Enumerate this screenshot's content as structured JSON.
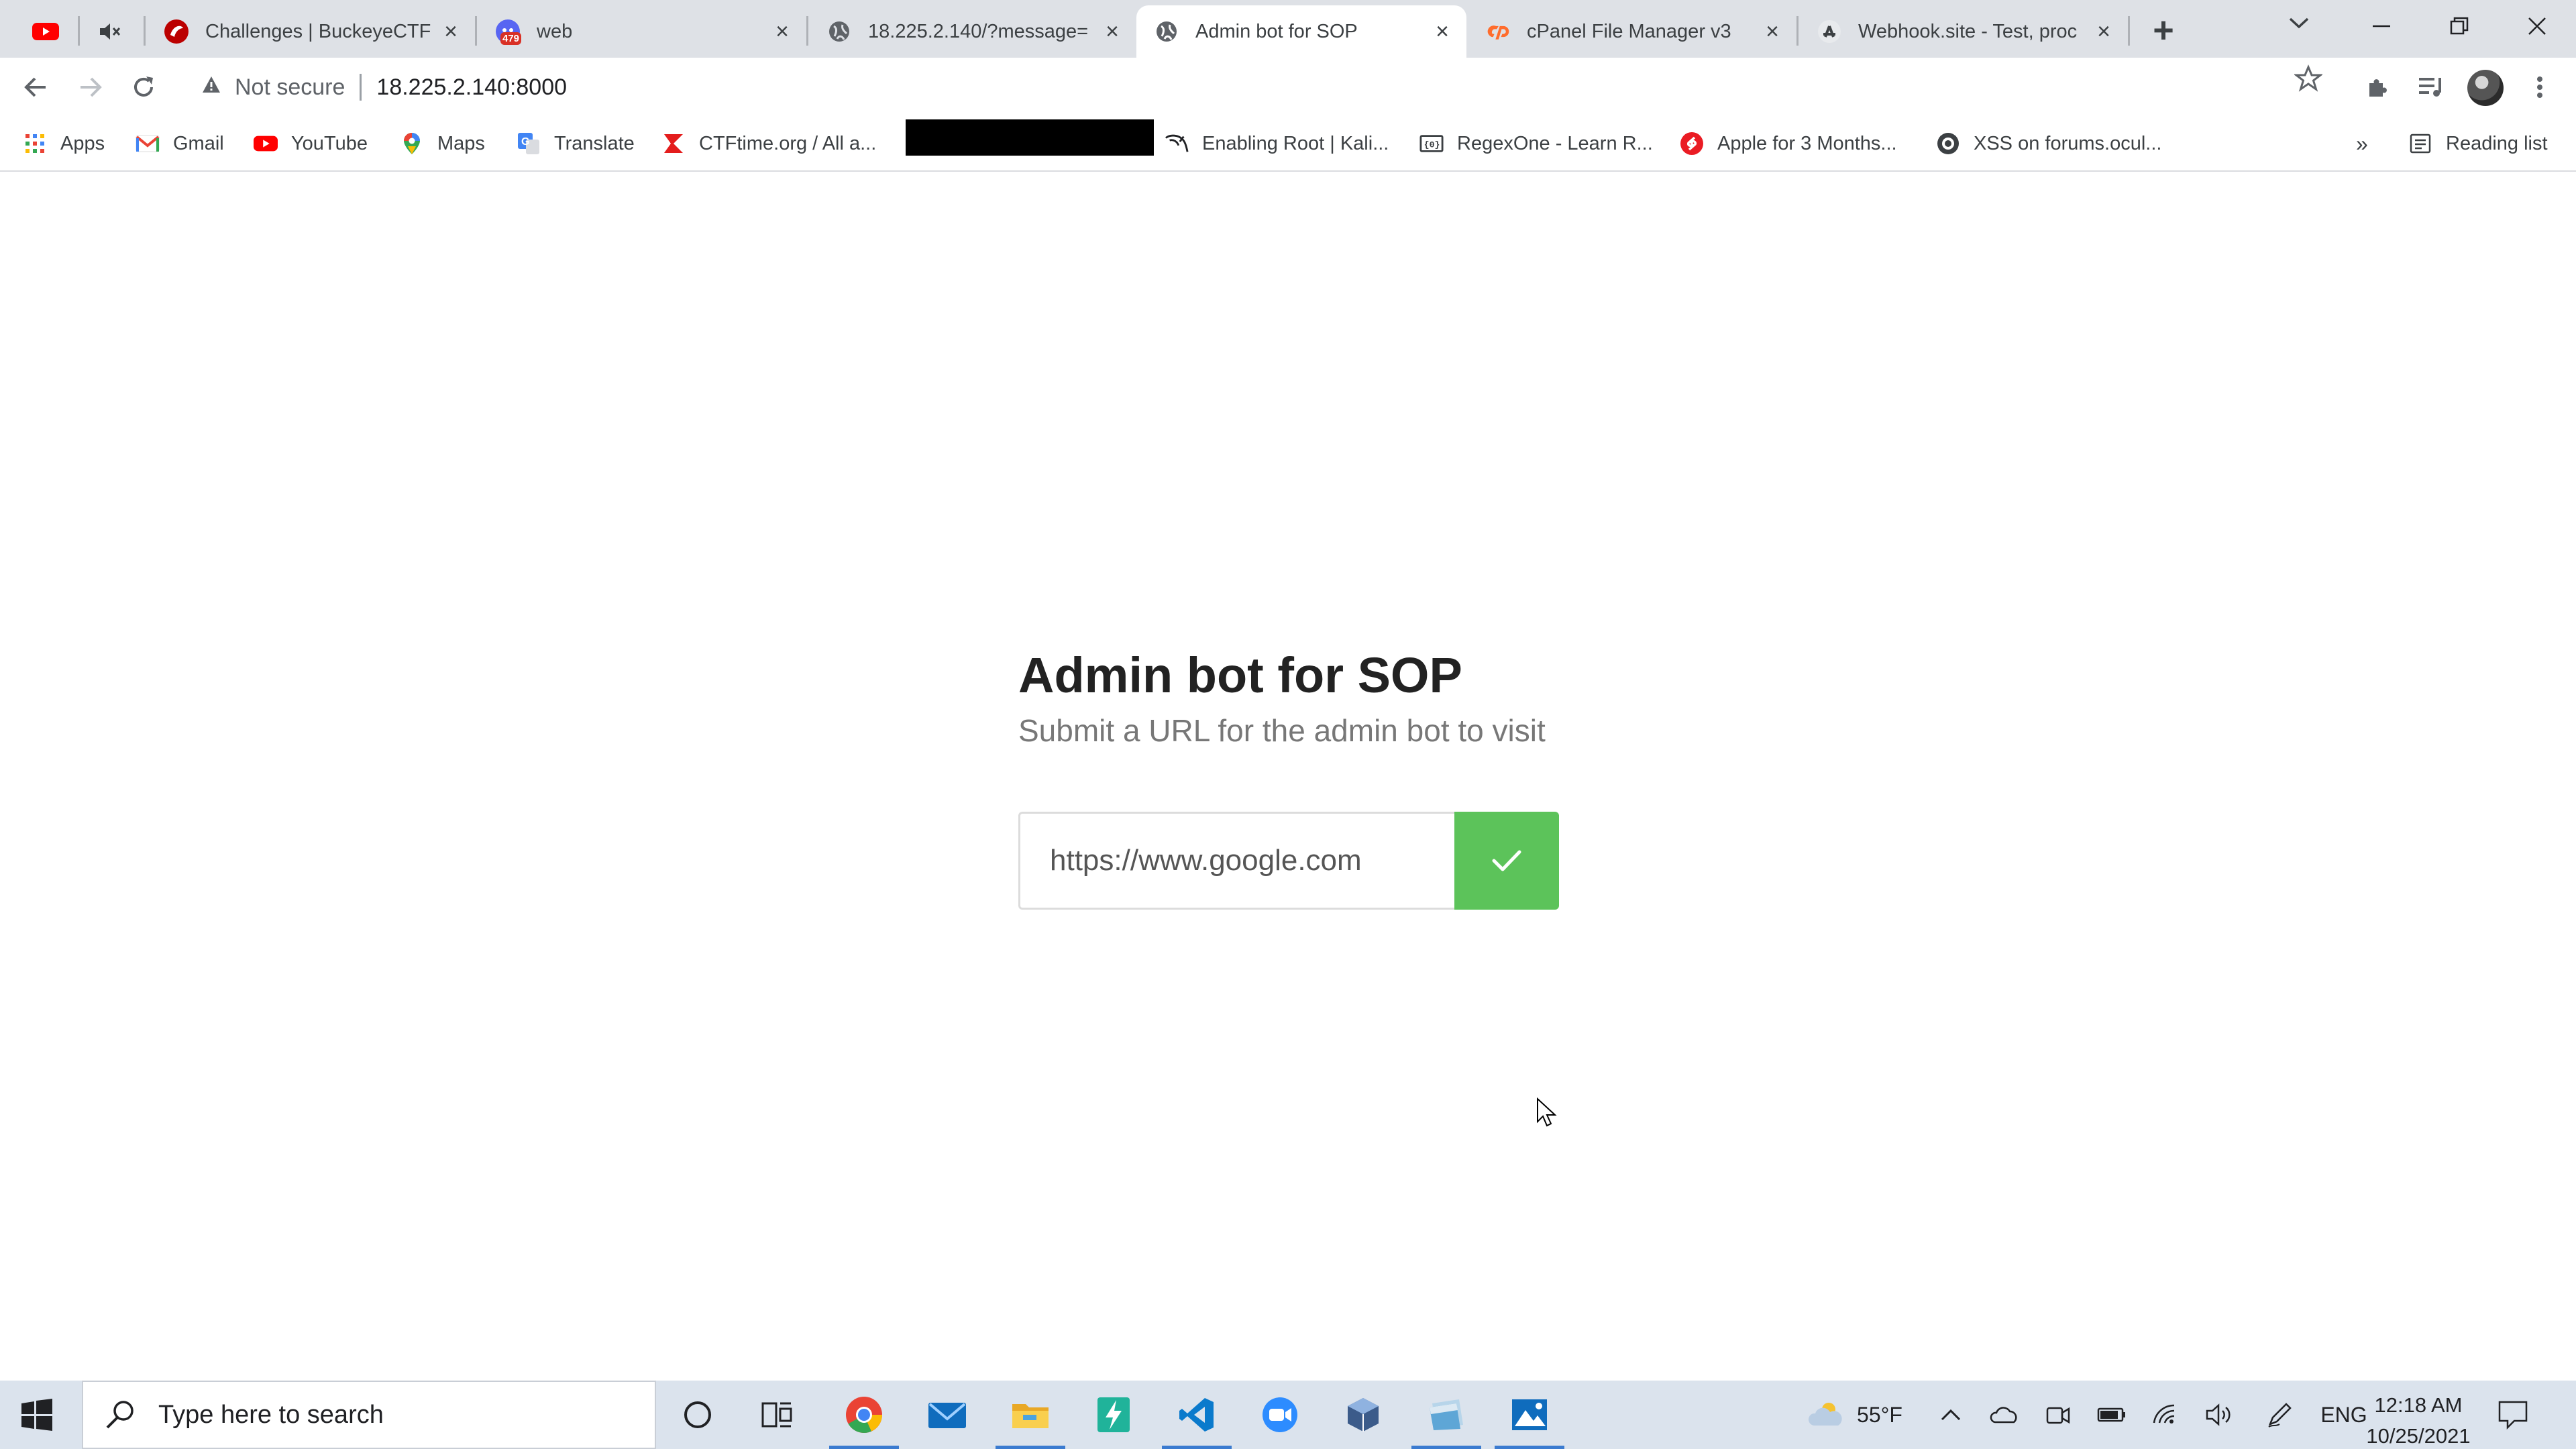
{
  "browser": {
    "tabs": [
      {
        "title": "Challenges | BuckeyeCTF",
        "favicon": "buckeyectf-icon"
      },
      {
        "title": "web",
        "favicon": "discord-icon",
        "badge": "479"
      },
      {
        "title": "18.225.2.140/?message=",
        "favicon": "globe-icon"
      },
      {
        "title": "Admin bot for SOP",
        "favicon": "globe-icon",
        "active": true
      },
      {
        "title": "cPanel File Manager v3",
        "favicon": "cpanel-icon"
      },
      {
        "title": "Webhook.site - Test, proc",
        "favicon": "webhook-icon"
      }
    ],
    "omnibox": {
      "security_label": "Not secure",
      "url": "18.225.2.140:8000"
    },
    "bookmarks": [
      {
        "label": "Apps",
        "icon": "apps-grid-icon"
      },
      {
        "label": "Gmail",
        "icon": "gmail-icon"
      },
      {
        "label": "YouTube",
        "icon": "youtube-icon"
      },
      {
        "label": "Maps",
        "icon": "maps-icon"
      },
      {
        "label": "Translate",
        "icon": "translate-icon"
      },
      {
        "label": "CTFtime.org / All a...",
        "icon": "ctftime-icon"
      },
      {
        "label": "Enabling Root | Kali...",
        "icon": "kali-icon"
      },
      {
        "label": "RegexOne - Learn R...",
        "icon": "regexone-icon"
      },
      {
        "label": "Apple for 3 Months...",
        "icon": "shazam-icon"
      },
      {
        "label": "XSS on forums.ocul...",
        "icon": "oculus-icon"
      }
    ],
    "reading_list_label": "Reading list"
  },
  "page": {
    "title": "Admin bot for SOP",
    "subtitle": "Submit a URL for the admin bot to visit",
    "url_input_value": "https://www.google.com",
    "accent_color": "#5cc35a"
  },
  "taskbar": {
    "search_placeholder": "Type here to search",
    "weather": "55°F",
    "language": "ENG",
    "time": "12:18 AM",
    "date": "10/25/2021"
  }
}
